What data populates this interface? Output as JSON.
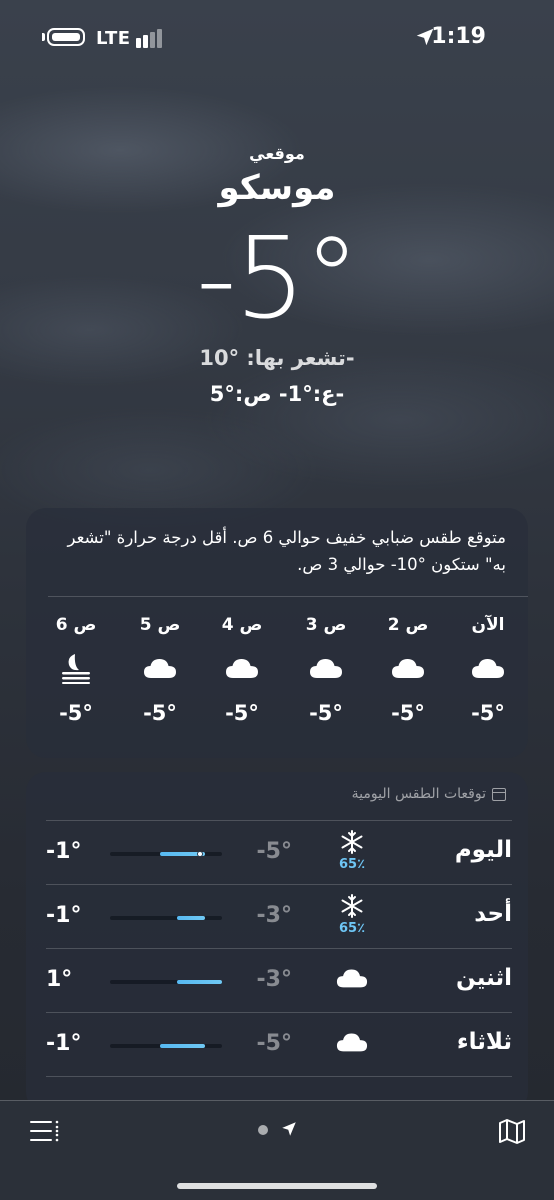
{
  "status_bar": {
    "network": "LTE",
    "time": "1:19"
  },
  "hero": {
    "label": "موقعي",
    "city": "موسكو",
    "temperature": "-5°",
    "feels_like": "تشعر بها: °10-",
    "high_low": "ع:°1-  ص:°5-"
  },
  "hourly": {
    "summary": "متوقع طقس ضبابي خفيف حوالي 6 ص. أقل درجة حرارة \"تشعر به\" ستكون °10- حوالي 3 ص.",
    "hours": [
      {
        "label": "الآن",
        "icon": "cloud-icon",
        "temp": "-5°"
      },
      {
        "label": "2 ص",
        "icon": "cloud-icon",
        "temp": "-5°"
      },
      {
        "label": "3 ص",
        "icon": "cloud-icon",
        "temp": "-5°"
      },
      {
        "label": "4 ص",
        "icon": "cloud-icon",
        "temp": "-5°"
      },
      {
        "label": "5 ص",
        "icon": "cloud-icon",
        "temp": "-5°"
      },
      {
        "label": "6 ص",
        "icon": "moon-fog-icon",
        "temp": "-5°"
      }
    ]
  },
  "daily": {
    "header": "توقعات الطقس اليومية",
    "days": [
      {
        "name": "اليوم",
        "icon": "snowflake-icon",
        "precip": "65٪",
        "low": "-5°",
        "high": "-1°",
        "range_start": 0.45,
        "range_end": 0.85,
        "current_marker": 0.8
      },
      {
        "name": "أحد",
        "icon": "snowflake-icon",
        "precip": "65٪",
        "low": "-3°",
        "high": "-1°",
        "range_start": 0.6,
        "range_end": 0.85
      },
      {
        "name": "اثنين",
        "icon": "cloud-icon",
        "precip": "",
        "low": "-3°",
        "high": "1°",
        "range_start": 0.6,
        "range_end": 1.0
      },
      {
        "name": "ثلاثاء",
        "icon": "cloud-icon",
        "precip": "",
        "low": "-5°",
        "high": "-1°",
        "range_start": 0.45,
        "range_end": 0.85
      }
    ]
  },
  "colors": {
    "range_bar": "#57b9f2",
    "precip": "#6ec6f5",
    "card_bg": "#282e3a"
  }
}
